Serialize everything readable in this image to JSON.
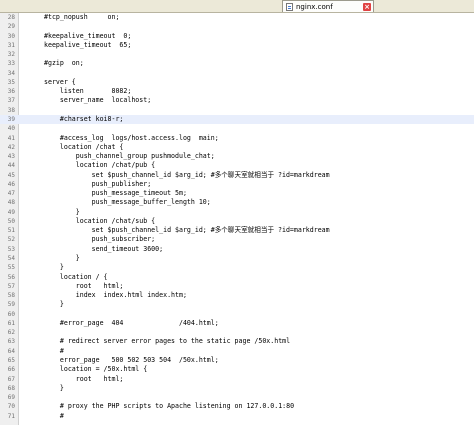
{
  "tab": {
    "title": "nginx.conf",
    "close_glyph": "×"
  },
  "current_line": 39,
  "lines": [
    {
      "num": "28",
      "text": "#tcp_nopush     on;"
    },
    {
      "num": "29",
      "text": ""
    },
    {
      "num": "30",
      "text": "#keepalive_timeout  0;"
    },
    {
      "num": "31",
      "text": "keepalive_timeout  65;"
    },
    {
      "num": "32",
      "text": ""
    },
    {
      "num": "33",
      "text": "#gzip  on;"
    },
    {
      "num": "34",
      "text": ""
    },
    {
      "num": "35",
      "text": "server {"
    },
    {
      "num": "36",
      "text": "    listen       8082;"
    },
    {
      "num": "37",
      "text": "    server_name  localhost;"
    },
    {
      "num": "38",
      "text": ""
    },
    {
      "num": "39",
      "text": "    #charset koi8-r;"
    },
    {
      "num": "40",
      "text": ""
    },
    {
      "num": "41",
      "text": "    #access_log  logs/host.access.log  main;"
    },
    {
      "num": "42",
      "text": "    location /chat {"
    },
    {
      "num": "43",
      "text": "        push_channel_group pushmodule_chat;"
    },
    {
      "num": "44",
      "text": "        location /chat/pub {"
    },
    {
      "num": "45",
      "text": "            set $push_channel_id $arg_id; #多个聊天室就相当于 ?id=markdream"
    },
    {
      "num": "46",
      "text": "            push_publisher;"
    },
    {
      "num": "47",
      "text": "            push_message_timeout 5m;"
    },
    {
      "num": "48",
      "text": "            push_message_buffer_length 10;"
    },
    {
      "num": "49",
      "text": "        }"
    },
    {
      "num": "50",
      "text": "        location /chat/sub {"
    },
    {
      "num": "51",
      "text": "            set $push_channel_id $arg_id; #多个聊天室就相当于 ?id=markdream"
    },
    {
      "num": "52",
      "text": "            push_subscriber;"
    },
    {
      "num": "53",
      "text": "            send_timeout 3600;"
    },
    {
      "num": "54",
      "text": "        }"
    },
    {
      "num": "55",
      "text": "    }"
    },
    {
      "num": "56",
      "text": "    location / {"
    },
    {
      "num": "57",
      "text": "        root   html;"
    },
    {
      "num": "58",
      "text": "        index  index.html index.htm;"
    },
    {
      "num": "59",
      "text": "    }"
    },
    {
      "num": "60",
      "text": ""
    },
    {
      "num": "61",
      "text": "    #error_page  404              /404.html;"
    },
    {
      "num": "62",
      "text": ""
    },
    {
      "num": "63",
      "text": "    # redirect server error pages to the static page /50x.html"
    },
    {
      "num": "64",
      "text": "    #"
    },
    {
      "num": "65",
      "text": "    error_page   500 502 503 504  /50x.html;"
    },
    {
      "num": "66",
      "text": "    location = /50x.html {"
    },
    {
      "num": "67",
      "text": "        root   html;"
    },
    {
      "num": "68",
      "text": "    }"
    },
    {
      "num": "69",
      "text": ""
    },
    {
      "num": "70",
      "text": "    # proxy the PHP scripts to Apache listening on 127.0.0.1:80"
    },
    {
      "num": "71",
      "text": "    #"
    }
  ]
}
